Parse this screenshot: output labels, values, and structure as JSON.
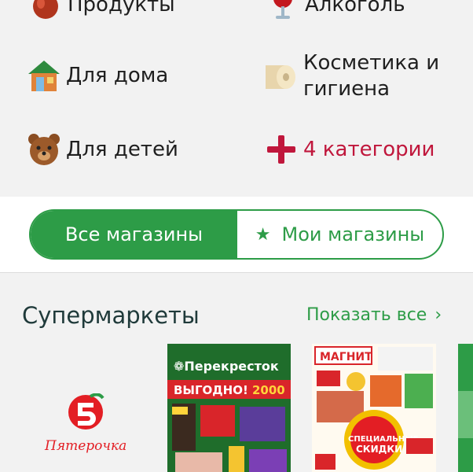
{
  "categories": [
    {
      "label": "Продукты",
      "icon": "apple-icon"
    },
    {
      "label": "Алкоголь",
      "icon": "wine-glass-icon"
    },
    {
      "label": "Для дома",
      "icon": "house-icon"
    },
    {
      "label": "Косметика и\nгигиена",
      "label_line1": "Косметика и",
      "label_line2": "гигиена",
      "icon": "toilet-paper-icon"
    },
    {
      "label": "Для детей",
      "icon": "teddy-bear-icon"
    },
    {
      "label": "4 категории",
      "icon": "plus-icon"
    }
  ],
  "segment": {
    "all_label": "Все магазины",
    "mine_label": "Мои магазины",
    "selected": "all"
  },
  "section": {
    "title": "Супермаркеты",
    "show_all": "Показать все"
  },
  "stores": [
    {
      "name": "Пятерочка",
      "logo_text": "Пятерочка"
    },
    {
      "name": "Перекресток",
      "flyer_brand": "Перекресток",
      "flyer_headline": "ВЫГОДНО!",
      "flyer_big": "2000"
    },
    {
      "name": "Магнит",
      "flyer_brand": "МАГНИТ",
      "flyer_badge1": "СПЕЦИАЛЬНЫЕ",
      "flyer_badge2": "СКИДКИ"
    }
  ],
  "colors": {
    "accent": "#2d9c47",
    "more": "#c0173c",
    "bg": "#f2f2f2"
  }
}
